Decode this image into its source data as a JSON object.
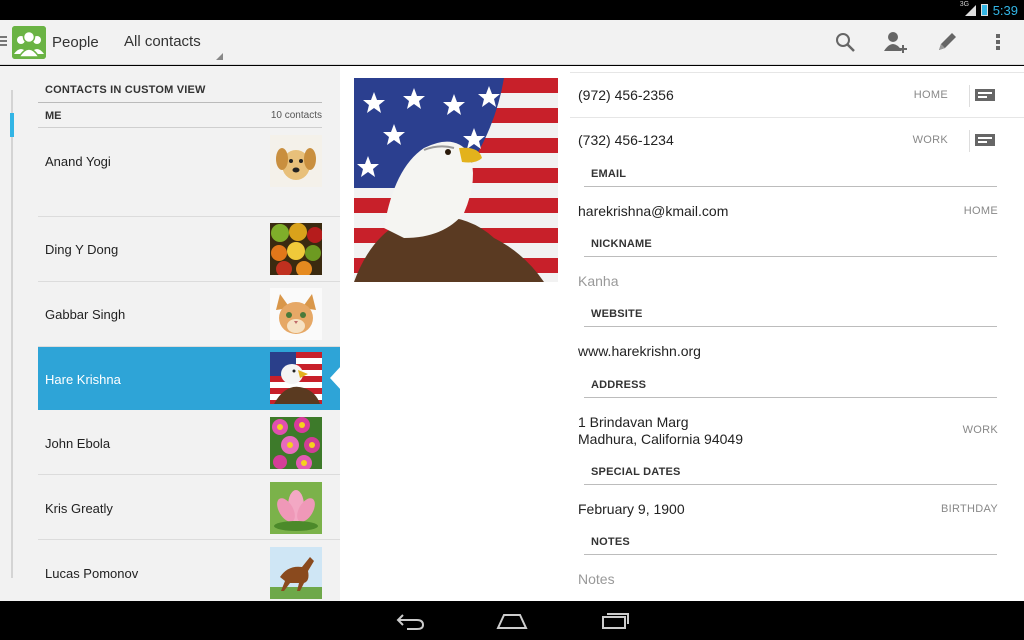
{
  "status_bar": {
    "time": "5:39",
    "network": "3G"
  },
  "action_bar": {
    "app_title": "People",
    "filter": "All contacts",
    "actions": [
      "search-icon",
      "add-contact-icon",
      "edit-icon",
      "overflow-menu-icon"
    ]
  },
  "list": {
    "section_header": "CONTACTS IN CUSTOM VIEW",
    "me_label": "ME",
    "count": "10 contacts",
    "contacts": [
      {
        "name": "Anand Yogi",
        "photo": "puppy"
      },
      {
        "name": "Ding Y Dong",
        "photo": "fruit"
      },
      {
        "name": "Gabbar Singh",
        "photo": "kitten"
      },
      {
        "name": "Hare Krishna",
        "photo": "eagle-flag",
        "selected": true
      },
      {
        "name": "John Ebola",
        "photo": "flowers"
      },
      {
        "name": "Kris Greatly",
        "photo": "lotus"
      },
      {
        "name": "Lucas Pomonov",
        "photo": "horse"
      }
    ]
  },
  "detail": {
    "photo": "eagle-flag",
    "phones": [
      {
        "number": "(972) 456-2356",
        "type": "HOME"
      },
      {
        "number": "(732) 456-1234",
        "type": "WORK"
      }
    ],
    "email_header": "EMAIL",
    "email": {
      "value": "harekrishna@kmail.com",
      "type": "HOME"
    },
    "nickname_header": "NICKNAME",
    "nickname": "Kanha",
    "website_header": "WEBSITE",
    "website": "www.harekrishn.org",
    "address_header": "ADDRESS",
    "address_line1": "1 Brindavan Marg",
    "address_line2": "Madhura, California 94049",
    "address_type": "WORK",
    "dates_header": "SPECIAL DATES",
    "date": {
      "value": "February 9, 1900",
      "type": "BIRTHDAY"
    },
    "notes_header": "NOTES",
    "notes_placeholder": "Notes"
  },
  "nav_bar": {
    "buttons": [
      "back-icon",
      "home-icon",
      "recents-icon"
    ]
  },
  "colors": {
    "accent": "#33b5e5",
    "selected_row": "#2ea4d7",
    "app_icon": "#6ab344"
  }
}
